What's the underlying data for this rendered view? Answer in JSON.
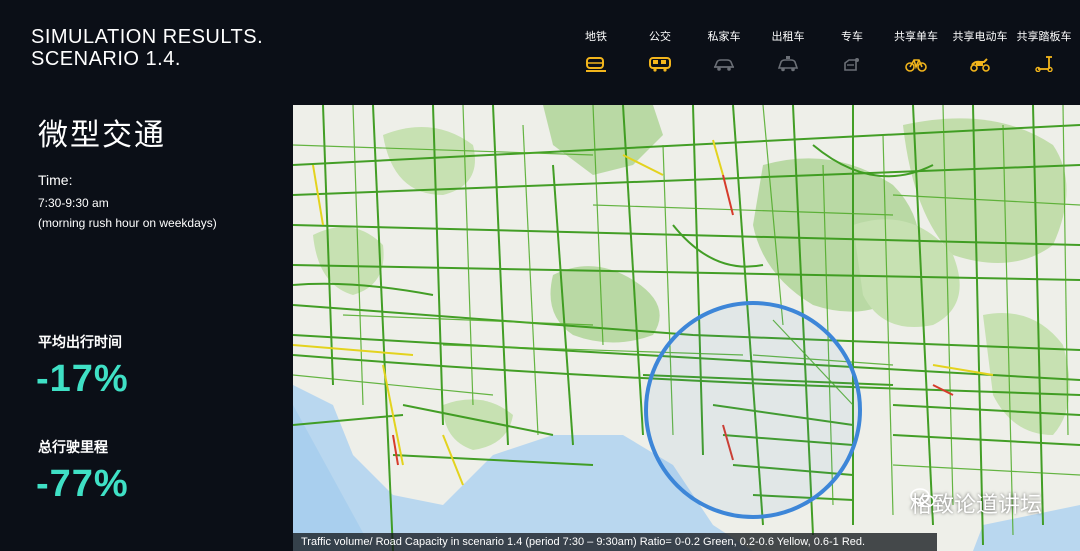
{
  "header": {
    "title_line1": "SIMULATION RESULTS.",
    "title_line2": "SCENARIO 1.4."
  },
  "modes": [
    {
      "label": "地铁",
      "icon": "metro-icon",
      "color": "#f2b51c"
    },
    {
      "label": "公交",
      "icon": "bus-icon",
      "color": "#f2b51c"
    },
    {
      "label": "私家车",
      "icon": "car-icon",
      "color": "#6b6f76"
    },
    {
      "label": "出租车",
      "icon": "taxi-icon",
      "color": "#6b6f76"
    },
    {
      "label": "专车",
      "icon": "ride-hailing-icon",
      "color": "#6b6f76"
    },
    {
      "label": "共享单车",
      "icon": "bicycle-icon",
      "color": "#f2b51c"
    },
    {
      "label": "共享电动车",
      "icon": "scooter-icon",
      "color": "#f2b51c"
    },
    {
      "label": "共享踏板车",
      "icon": "kick-scooter-icon",
      "color": "#f2b51c"
    }
  ],
  "sidebar": {
    "heading": "微型交通",
    "time_label": "Time:",
    "time_value": "7:30-9:30 am",
    "time_note": "(morning rush hour on weekdays)",
    "metric1_label": "平均出行时间",
    "metric1_value": "-17%",
    "metric2_label": "总行驶里程",
    "metric2_value": "-77%",
    "accent_color": "#3fe0c5"
  },
  "map": {
    "caption": "Traffic volume/ Road Capacity in scenario 1.4 (period 7:30 – 9:30am) Ratio= 0-0.2 Green, 0.2-0.6 Yellow, 0.6-1 Red.",
    "watermark": "格致论道讲坛",
    "highlight_color": "#3d86d8"
  }
}
